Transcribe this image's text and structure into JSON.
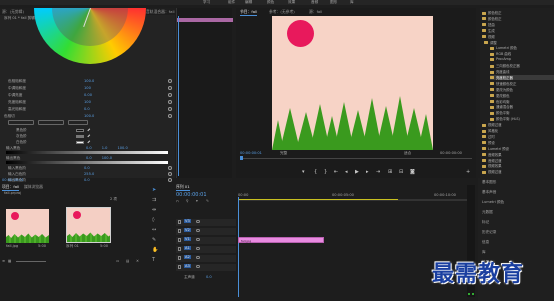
{
  "top_menu": [
    "学习",
    "组件",
    "编辑",
    "颜色",
    "效果",
    "音频",
    "图形",
    "库"
  ],
  "effect_controls": {
    "tabs": [
      "源：(无剪辑)",
      "效果控件",
      "Lumetri 范围",
      "音频剪辑混合器：fall",
      "音轨混合器：fall"
    ],
    "clip_label": "序列 01 * fall 剪辑",
    "rows": [
      {
        "label": "色相饱和度",
        "value": "100.0"
      },
      {
        "label": "中调饱和度",
        "value": "100"
      },
      {
        "label": "中调亮度",
        "value": "0.00"
      },
      {
        "label": "亮度饱和度",
        "value": "100"
      },
      {
        "label": "高光饱和度",
        "value": "0.0"
      },
      {
        "label": "色相切",
        "value": "100.0"
      }
    ],
    "color_pickers": [
      {
        "label": "黑色阶",
        "value": ""
      },
      {
        "label": "灰色阶",
        "value": ""
      },
      {
        "label": "白色阶",
        "value": ""
      }
    ],
    "input_range": {
      "label": "输入黑色",
      "min": "0.0",
      "mid": "1.0",
      "max": "100.0"
    },
    "output_range": {
      "label": "输出黑色",
      "min": "0.0",
      "max": "100.0"
    },
    "bottom_rows": [
      {
        "label": "输入黑色阶",
        "value": "0.0"
      },
      {
        "label": "输入白色阶",
        "value": "255.0"
      },
      {
        "label": "输出黑色阶",
        "value": "0.0"
      }
    ],
    "timecode": "00:00:00:01"
  },
  "program_monitor": {
    "tabs": [
      "节目：fall",
      "参考：(无参考)",
      "源：fall"
    ],
    "timecode_left": "00:00:00:01",
    "fit": "完整",
    "quality": "适合",
    "timecode_right": "00:00:00:00",
    "controls": [
      "add-marker",
      "in",
      "out",
      "go-in",
      "step-back",
      "play",
      "step-forward",
      "go-out",
      "insert",
      "overwrite",
      "export-frame",
      "settings"
    ]
  },
  "effects_panel": {
    "items": [
      "颜色校正",
      "颜色校正",
      "扭曲",
      "生成",
      "视频",
      "调整",
      "Lumetri 颜色",
      "RGB 曲线",
      "ProcAmp",
      "三向颜色校正器",
      "亮度曲线",
      "亮度校正器",
      "快速颜色校正",
      "更改为颜色",
      "更改颜色",
      "色彩均衡",
      "通道混合器",
      "颜色平衡",
      "颜色平衡 (HLS)",
      "视频过渡",
      "风格化",
      "过时",
      "预设",
      "Lumetri 预设",
      "音频效果",
      "音频过渡",
      "视频效果",
      "视频过渡"
    ]
  },
  "project_panel": {
    "tabs": [
      "项目：fall",
      "媒体浏览器"
    ],
    "project_name": "fall.prproj",
    "items": [
      {
        "name": "fall.jpg",
        "duration": "5:00"
      },
      {
        "name": "序列 01",
        "duration": "5:00"
      }
    ],
    "item_count": "2 项"
  },
  "timeline": {
    "tab": "序列 01",
    "timecode": "00:00:00:01",
    "ruler": [
      "00:00",
      "00:00:05:00",
      "00:00:10:00"
    ],
    "video_tracks": [
      "V3",
      "V2",
      "V1"
    ],
    "audio_tracks": [
      "A1",
      "A2",
      "A3"
    ],
    "master": "主声道",
    "master_value": "0.0",
    "clip_label": "fall.jpg"
  },
  "right_panel": {
    "items": [
      "基本图形",
      "基本声音",
      "Lumetri 颜色",
      "元数据",
      "标记",
      "历史记录",
      "信息",
      "库",
      "效果"
    ]
  },
  "watermark": "最需教育",
  "colors": {
    "accent": "#4a8fd8",
    "sun": "#e8195c",
    "sky": "#f7d3c6",
    "trees": "#3a9a1e",
    "clip": "#e88ae0"
  }
}
